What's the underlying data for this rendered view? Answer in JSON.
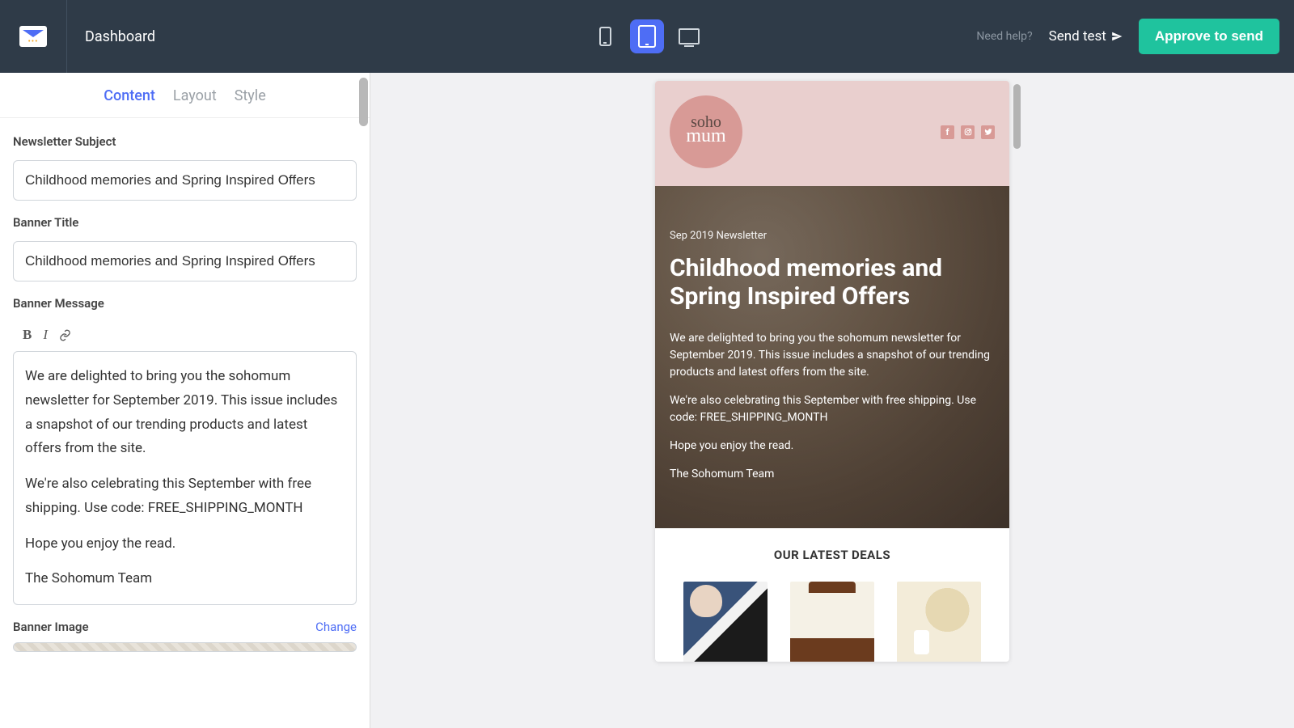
{
  "topbar": {
    "dashboard": "Dashboard",
    "need_help": "Need help?",
    "send_test": "Send test",
    "approve": "Approve to send"
  },
  "tabs": {
    "content": "Content",
    "layout": "Layout",
    "style": "Style"
  },
  "labels": {
    "subject": "Newsletter Subject",
    "banner_title": "Banner Title",
    "banner_message": "Banner Message",
    "banner_image": "Banner Image",
    "change": "Change"
  },
  "fields": {
    "subject": "Childhood memories and Spring Inspired Offers",
    "banner_title": "Childhood memories and Spring Inspired Offers",
    "message_p1": "We are delighted to bring you the sohomum newsletter for September 2019. This issue includes a snapshot of our trending products and latest offers from the site.",
    "message_p2": "We're also celebrating this September with free shipping. Use code: FREE_SHIPPING_MONTH",
    "message_p3": "Hope you enjoy the read.",
    "message_p4": "The Sohomum Team"
  },
  "preview": {
    "brand_script": "soho",
    "brand_serif": "mum",
    "date_line": "Sep 2019 Newsletter",
    "title": "Childhood memories and Spring Inspired Offers",
    "p1": "We are delighted to bring you the sohomum newsletter for September 2019. This issue includes a snapshot of our trending products and latest offers from the site.",
    "p2": "We're also celebrating this September with free shipping. Use code: FREE_SHIPPING_MONTH",
    "p3": "Hope you enjoy the read.",
    "p4": "The Sohomum Team",
    "deals_title": "OUR LATEST DEALS"
  }
}
